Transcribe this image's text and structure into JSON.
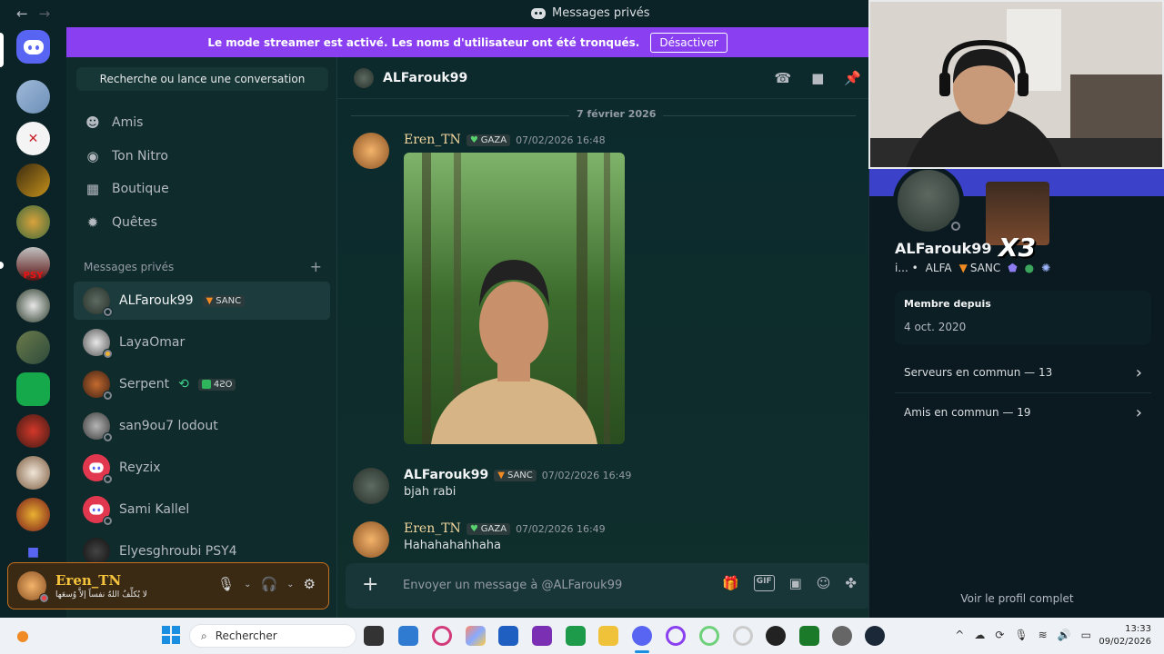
{
  "window": {
    "title": "Messages privés"
  },
  "banner": {
    "text": "Le mode streamer est activé. Les noms d'utilisateur ont été tronqués.",
    "button": "Désactiver"
  },
  "sidebar": {
    "search": "Recherche ou lance une conversation",
    "nav": [
      {
        "label": "Amis",
        "icon": "person-wave-icon"
      },
      {
        "label": "Ton Nitro",
        "icon": "nitro-icon"
      },
      {
        "label": "Boutique",
        "icon": "shop-icon"
      },
      {
        "label": "Quêtes",
        "icon": "quest-icon"
      }
    ],
    "dm_header": "Messages privés",
    "dm_add": "+",
    "dms": [
      {
        "name": "ALFarouk99",
        "tag": "SANC"
      },
      {
        "name": "LayaOmar"
      },
      {
        "name": "Serpent",
        "tag": "4ƧO"
      },
      {
        "name": "san9ou7 lodout"
      },
      {
        "name": "Reyzix"
      },
      {
        "name": "Sami Kallel"
      },
      {
        "name": "Elyesghroubi PSY4"
      }
    ]
  },
  "userbar": {
    "name": "Eren_TN",
    "status": "لا يُكلِّفُ اللهُ نفساً إلاَّ وُسعَها"
  },
  "channel": {
    "name": "ALFarouk99",
    "date_separator": "7 février 2026",
    "messages": [
      {
        "author": "Eren_TN",
        "tag": "GAZA",
        "time": "07/02/2026 16:48",
        "text": ""
      },
      {
        "author": "ALFarouk99",
        "tag": "SANC",
        "time": "07/02/2026 16:49",
        "text": "bjah rabi"
      },
      {
        "author": "Eren_TN",
        "tag": "GAZA",
        "time": "07/02/2026 16:49",
        "text": "Hahahahahhaha"
      }
    ],
    "composer_placeholder": "Envoyer un message à @ALFarouk99"
  },
  "profile": {
    "name": "ALFarouk99",
    "overlay_text": "X3",
    "sub_prefix": "i... •",
    "clan": "ALFA",
    "tag": "SANC",
    "member_since_label": "Membre depuis",
    "member_since": "4 oct. 2020",
    "servers_common": "Serveurs en commun — 13",
    "friends_common": "Amis en commun — 19",
    "full_profile": "Voir le profil complet"
  },
  "taskbar": {
    "search": "Rechercher",
    "time": "13:33",
    "date": "09/02/2026"
  },
  "colors": {
    "accent": "#5865f2",
    "banner": "#8a3ff0",
    "gold": "#f6c33c"
  }
}
